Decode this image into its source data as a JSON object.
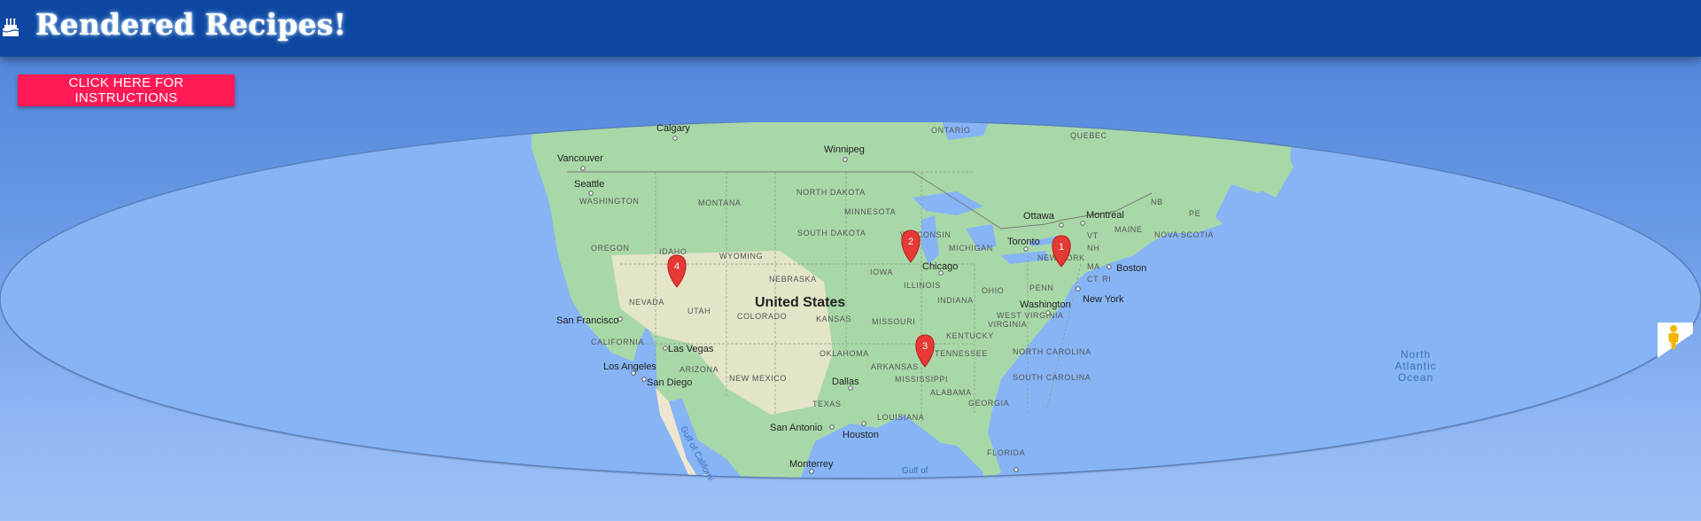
{
  "header": {
    "title": "Rendered Recipes!",
    "icon": "cake-icon",
    "background": "#0d47a1"
  },
  "instructions_button": {
    "label": "CLICK HERE FOR INSTRUCTIONS",
    "color": "#ff1a55"
  },
  "map": {
    "ocean_color": "#87b4f5",
    "land_color": "#a8d8a8",
    "desert_color": "#efe6cf",
    "country_label": "United States",
    "ocean_label_lines": [
      "North",
      "Atlantic",
      "Ocean"
    ],
    "gulf_labels": [
      "Gulf of",
      "Gulf of California"
    ],
    "city_labels": [
      "Calgary",
      "Winnipeg",
      "Vancouver",
      "Seattle",
      "Ottawa",
      "Montreal",
      "Toronto",
      "Boston",
      "Chicago",
      "New York",
      "Washington",
      "San Francisco",
      "Las Vegas",
      "Los Angeles",
      "San Diego",
      "Dallas",
      "San Antonio",
      "Houston",
      "Monterrey"
    ],
    "region_labels": [
      "ONTARIO",
      "QUEBEC",
      "WASHINGTON",
      "MONTANA",
      "NORTH DAKOTA",
      "MINNESOTA",
      "OREGON",
      "IDAHO",
      "WYOMING",
      "SOUTH DAKOTA",
      "WISCONSIN",
      "MICHIGAN",
      "NEW YORK",
      "VT",
      "NH",
      "MA",
      "CT",
      "RI",
      "NB",
      "PE",
      "MAINE",
      "NOVA SCOTIA",
      "IOWA",
      "NEBRASKA",
      "ILLINOIS",
      "INDIANA",
      "OHIO",
      "PENN",
      "NEVADA",
      "UTAH",
      "COLORADO",
      "KANSAS",
      "MISSOURI",
      "WEST VIRGINIA",
      "VIRGINIA",
      "KENTUCKY",
      "CALIFORNIA",
      "ARIZONA",
      "NEW MEXICO",
      "OKLAHOMA",
      "ARKANSAS",
      "TENNESSEE",
      "NORTH CAROLINA",
      "SOUTH CAROLINA",
      "MISSISSIPPI",
      "ALABAMA",
      "GEORGIA",
      "TEXAS",
      "LOUISIANA",
      "FLORIDA"
    ],
    "markers": [
      {
        "label": "1",
        "near": "New York"
      },
      {
        "label": "2",
        "near": "Wisconsin"
      },
      {
        "label": "3",
        "near": "Mississippi"
      },
      {
        "label": "4",
        "near": "Utah"
      }
    ],
    "marker_color": "#e53935",
    "pegman_icon": "pegman-icon"
  }
}
